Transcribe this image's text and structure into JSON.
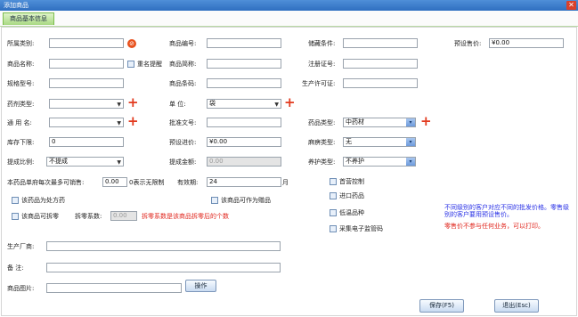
{
  "window": {
    "title": "添加商品"
  },
  "tabs": [
    {
      "label": "商品基本信息"
    }
  ],
  "row1": {
    "category_label": "所属类别:",
    "code_label": "商品编号:",
    "storage_label": "储藏条件:",
    "sell_price_label": "预设售价:",
    "sell_price_value": "¥0.00"
  },
  "row2": {
    "name_label": "商品名称:",
    "dup_check_label": "重名提醒",
    "short_label": "商品简称:",
    "reg_label": "注册证号:"
  },
  "row3": {
    "spec_label": "规格型号:",
    "barcode_label": "商品条码:",
    "license_label": "生产许可证:"
  },
  "row4": {
    "drug_type_label": "药剂类型:",
    "unit_label": "单      位:",
    "unit_value": "袋"
  },
  "row5": {
    "generic_label": "通  用  名:",
    "approval_label": "批准文号:",
    "drug_class_label": "药品类型:",
    "drug_class_value": "中药材"
  },
  "row6": {
    "stock_min_label": "库存下限:",
    "stock_min_value": "0",
    "buy_price_label": "预设进价:",
    "buy_price_value": "¥0.00",
    "ephedrine_label": "麻痹类型:",
    "ephedrine_value": "无"
  },
  "row7": {
    "commission_label": "提成比例:",
    "commission_value": "不提成",
    "commission_amt_label": "提成金额:",
    "commission_amt_value": "0.00",
    "care_label": "养护类型:",
    "care_value": "不养护"
  },
  "row8": {
    "max_qty_label": "本药品单府每次最多可销售:",
    "max_qty_value": "0.00",
    "unlimited_note": "0表示无限制",
    "validity_label": "有效期:",
    "validity_value": "24",
    "month_label": "月"
  },
  "checks_left": {
    "rx": "该药品为处方药",
    "gift": "该商品可作为赠品",
    "split": "该商品可拆零",
    "split_coef_label": "拆零系数:",
    "split_coef_value": "0.00",
    "split_note": "拆零系数是该商品拆零后的个数"
  },
  "checks_right": {
    "first_camp": "首营控制",
    "imported": "进口药品",
    "low_price": "低温品种",
    "electronic": "采集电子监管码"
  },
  "notes": {
    "blue": "不同级别的客户对应不同的批发价格。零售级别的客户要用预设售价。",
    "red": "零售价不参与任何业务，可以打印。"
  },
  "bottom": {
    "manufacturer_label": "生产厂商:",
    "remark_label": "备      注:",
    "image_label": "商品图片:",
    "image_btn": "操作",
    "save_btn": "保存(F5)",
    "exit_btn": "退出(Esc)"
  },
  "colors": {
    "title_bar": "#2f6fc0",
    "tab_green": "#a9d983",
    "plus_red": "#e23b1f",
    "note_blue": "#2a32e6",
    "note_red": "#e0251c"
  }
}
